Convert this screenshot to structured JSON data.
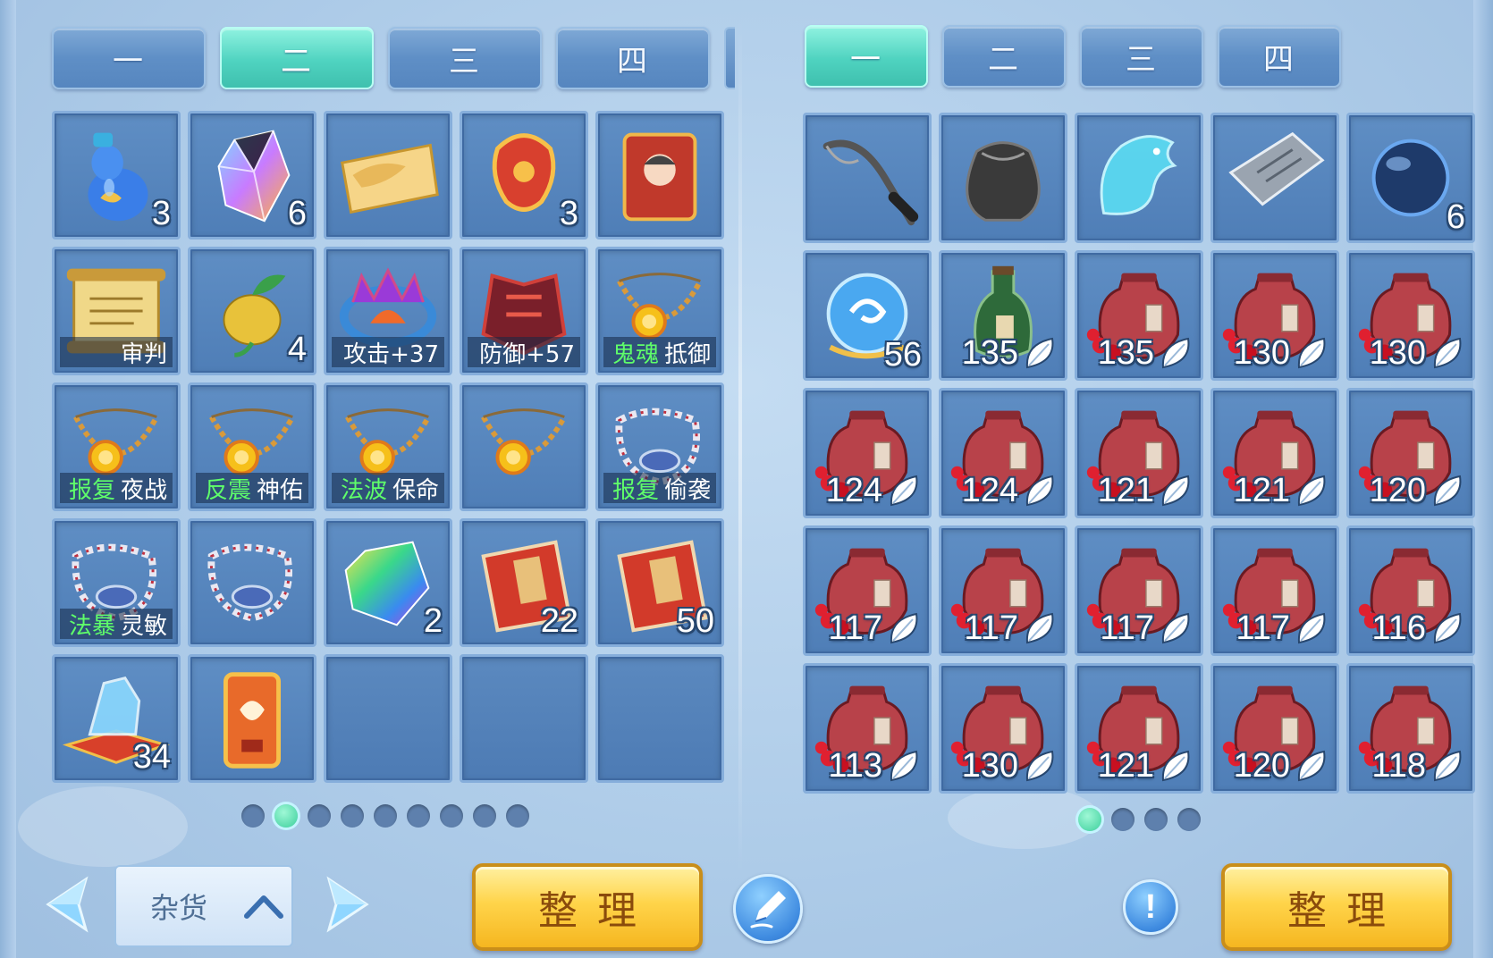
{
  "left_panel": {
    "tabs": [
      {
        "label": "一",
        "active": false
      },
      {
        "label": "二",
        "active": true
      },
      {
        "label": "三",
        "active": false
      },
      {
        "label": "四",
        "active": false
      }
    ],
    "slots": [
      {
        "icon": "blue-gourd-potion-icon",
        "count": "3"
      },
      {
        "icon": "rainbow-crystal-icon",
        "count": "6"
      },
      {
        "icon": "gold-ingot-scroll-icon"
      },
      {
        "icon": "red-flame-talisman-icon",
        "count": "3"
      },
      {
        "icon": "red-portrait-banner-icon"
      },
      {
        "icon": "golden-scroll-icon",
        "label": [
          {
            "text": "审判",
            "green": false
          }
        ]
      },
      {
        "icon": "golden-fruit-icon",
        "count": "4"
      },
      {
        "icon": "flame-crown-icon",
        "label": [
          {
            "text": "攻击+37",
            "green": false
          }
        ]
      },
      {
        "icon": "red-armor-icon",
        "label": [
          {
            "text": "防御+57",
            "green": false
          }
        ]
      },
      {
        "icon": "sun-necklace-icon",
        "label": [
          {
            "text": "鬼魂",
            "green": true
          },
          {
            "text": "抵御",
            "green": false
          }
        ]
      },
      {
        "icon": "sun-necklace-icon",
        "label": [
          {
            "text": "报复",
            "green": true
          },
          {
            "text": "夜战",
            "green": false
          }
        ]
      },
      {
        "icon": "sun-necklace-icon",
        "label": [
          {
            "text": "反震",
            "green": true
          },
          {
            "text": "神佑",
            "green": false
          }
        ]
      },
      {
        "icon": "sun-necklace-icon",
        "label": [
          {
            "text": "法波",
            "green": true
          },
          {
            "text": "保命",
            "green": false
          }
        ]
      },
      {
        "icon": "sun-necklace-icon"
      },
      {
        "icon": "bead-necklace-icon",
        "label": [
          {
            "text": "报复",
            "green": true
          },
          {
            "text": "偷袭",
            "green": false
          }
        ]
      },
      {
        "icon": "bead-necklace-icon",
        "label": [
          {
            "text": "法暴",
            "green": true
          },
          {
            "text": "灵敏",
            "green": false
          }
        ]
      },
      {
        "icon": "bead-necklace-icon"
      },
      {
        "icon": "rainbow-gem-icon",
        "count": "2"
      },
      {
        "icon": "red-book-icon",
        "count": "22"
      },
      {
        "icon": "red-book-icon",
        "count": "50"
      },
      {
        "icon": "ice-crystal-cushion-icon",
        "count": "34"
      },
      {
        "icon": "phoenix-plaque-icon"
      },
      {
        "icon": "empty"
      },
      {
        "icon": "empty"
      },
      {
        "icon": "empty"
      }
    ],
    "pages": {
      "total": 9,
      "active": 1
    },
    "category": {
      "label": "杂货"
    },
    "sort_label": "整理"
  },
  "right_panel": {
    "tabs": [
      {
        "label": "一",
        "active": true
      },
      {
        "label": "二",
        "active": false
      },
      {
        "label": "三",
        "active": false
      },
      {
        "label": "四",
        "active": false
      }
    ],
    "slots": [
      {
        "icon": "fishing-rod-icon"
      },
      {
        "icon": "black-pouch-icon"
      },
      {
        "icon": "spirit-horse-icon"
      },
      {
        "icon": "silver-plate-icon"
      },
      {
        "icon": "dark-orb-icon",
        "count": "6"
      },
      {
        "icon": "swirl-orb-icon",
        "count": "56"
      },
      {
        "icon": "green-wine-bottle-icon",
        "count": "135",
        "leaf": true
      },
      {
        "icon": "wine-jar-icon",
        "count": "135",
        "leaf": true
      },
      {
        "icon": "wine-jar-icon",
        "count": "130",
        "leaf": true
      },
      {
        "icon": "wine-jar-icon",
        "count": "130",
        "leaf": true
      },
      {
        "icon": "wine-jar-icon",
        "count": "124",
        "leaf": true
      },
      {
        "icon": "wine-jar-icon",
        "count": "124",
        "leaf": true
      },
      {
        "icon": "wine-jar-icon",
        "count": "121",
        "leaf": true
      },
      {
        "icon": "wine-jar-icon",
        "count": "121",
        "leaf": true
      },
      {
        "icon": "wine-jar-icon",
        "count": "120",
        "leaf": true
      },
      {
        "icon": "wine-jar-icon",
        "count": "117",
        "leaf": true
      },
      {
        "icon": "wine-jar-icon",
        "count": "117",
        "leaf": true
      },
      {
        "icon": "wine-jar-icon",
        "count": "117",
        "leaf": true
      },
      {
        "icon": "wine-jar-icon",
        "count": "117",
        "leaf": true
      },
      {
        "icon": "wine-jar-icon",
        "count": "116",
        "leaf": true
      },
      {
        "icon": "wine-jar-icon",
        "count": "113",
        "leaf": true
      },
      {
        "icon": "wine-jar-icon",
        "count": "130",
        "leaf": true
      },
      {
        "icon": "wine-jar-icon",
        "count": "121",
        "leaf": true
      },
      {
        "icon": "wine-jar-icon",
        "count": "120",
        "leaf": true
      },
      {
        "icon": "wine-jar-icon",
        "count": "118",
        "leaf": true
      }
    ],
    "pages": {
      "total": 4,
      "active": 0
    },
    "sort_label": "整理"
  },
  "colors": {
    "accent_teal": "#4fd3c0",
    "slot_blue": "#4f7eb7",
    "affix_green": "#5fff6a",
    "button_gold": "#ffd44a"
  }
}
